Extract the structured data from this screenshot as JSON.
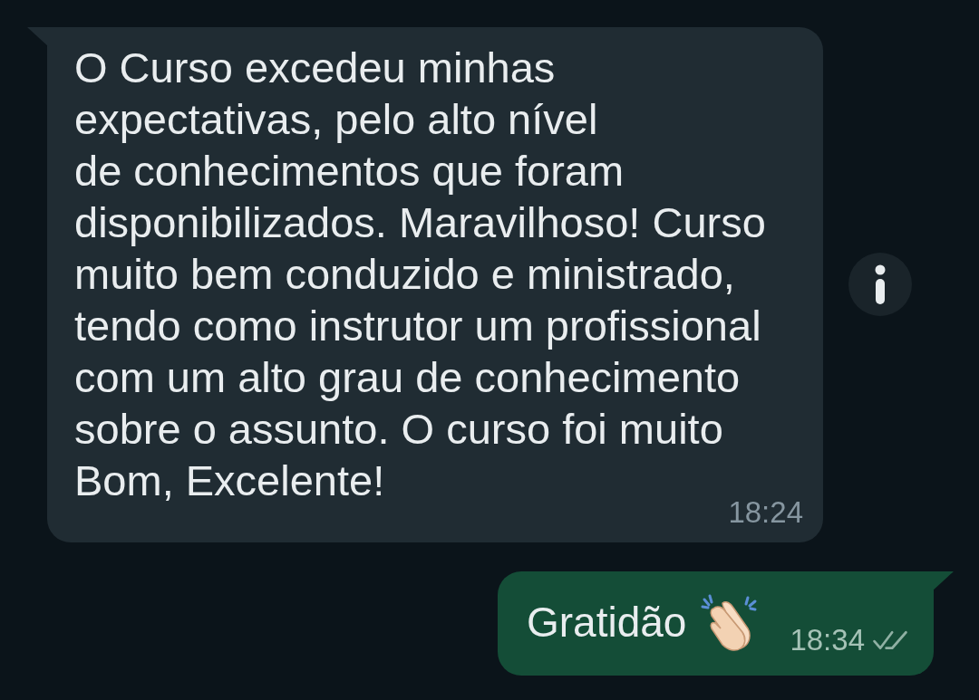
{
  "messages": [
    {
      "kind": "incoming",
      "text": "O Curso excedeu minhas\nexpectativas, pelo alto nível\nde conhecimentos que foram\ndisponibilizados. Maravilhoso! Curso\nmuito bem conduzido e ministrado,\ntendo como instrutor um profissional\ncom um alto grau de conhecimento\nsobre o assunto. O curso foi muito\nBom, Excelente!",
      "time": "18:24"
    },
    {
      "kind": "outgoing",
      "text": "Gratidão",
      "time": "18:34",
      "read": false
    }
  ]
}
